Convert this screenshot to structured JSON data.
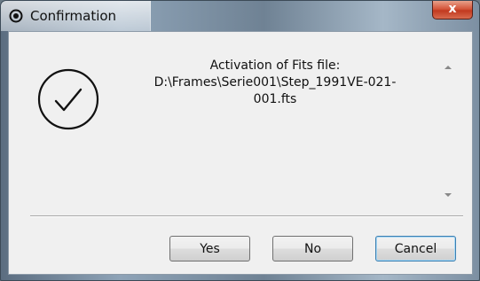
{
  "window": {
    "title": "Confirmation",
    "close_label": "x",
    "title_icon": "radio-dot-icon",
    "colors": {
      "close_button": "#c2391f",
      "default_button_border": "#3c7fb1",
      "dialog_background": "#f0f0f0"
    }
  },
  "dialog": {
    "icon": "checkmark-circle-icon",
    "message": {
      "line1": "Activation of Fits file:",
      "line2": "D:\\Frames\\Serie001\\Step_1991VE-021-",
      "line3": "001.fts"
    }
  },
  "buttons": {
    "yes": "Yes",
    "no": "No",
    "cancel": "Cancel"
  }
}
